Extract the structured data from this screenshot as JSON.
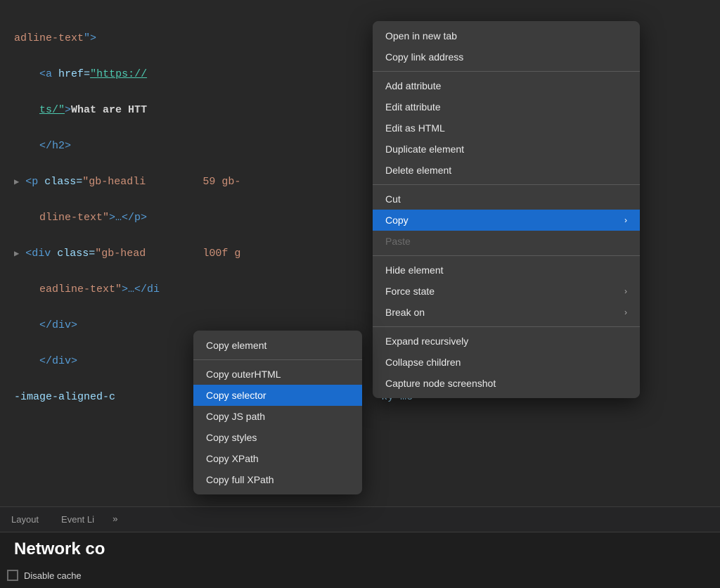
{
  "code_editor": {
    "lines": [
      {
        "content": "adline-text\">"
      },
      {
        "content": "  <a href=\"https://...\" ...>What are HTT"
      },
      {
        "content": "  ts/\">What are HTT"
      },
      {
        "content": "  </h2>"
      },
      {
        "content": "▶ <p class=\"gb-headli"
      },
      {
        "content": "  dline-text\">…</p>"
      },
      {
        "content": "▶ <div class=\"gb-head"
      },
      {
        "content": "  eadline-text\">…</di"
      },
      {
        "content": "  </div>"
      },
      {
        "content": "  </div>"
      },
      {
        "content": "-image-aligned-c"
      }
    ]
  },
  "right_context_menu": {
    "items": [
      {
        "id": "open-new-tab",
        "label": "Open in new tab",
        "type": "item",
        "has_arrow": false,
        "disabled": false
      },
      {
        "id": "copy-link-address",
        "label": "Copy link address",
        "type": "item",
        "has_arrow": false,
        "disabled": false
      },
      {
        "id": "sep1",
        "type": "separator"
      },
      {
        "id": "add-attribute",
        "label": "Add attribute",
        "type": "item",
        "has_arrow": false,
        "disabled": false
      },
      {
        "id": "edit-attribute",
        "label": "Edit attribute",
        "type": "item",
        "has_arrow": false,
        "disabled": false
      },
      {
        "id": "edit-as-html",
        "label": "Edit as HTML",
        "type": "item",
        "has_arrow": false,
        "disabled": false
      },
      {
        "id": "duplicate-element",
        "label": "Duplicate element",
        "type": "item",
        "has_arrow": false,
        "disabled": false
      },
      {
        "id": "delete-element",
        "label": "Delete element",
        "type": "item",
        "has_arrow": false,
        "disabled": false
      },
      {
        "id": "sep2",
        "type": "separator"
      },
      {
        "id": "cut",
        "label": "Cut",
        "type": "item",
        "has_arrow": false,
        "disabled": false
      },
      {
        "id": "copy",
        "label": "Copy",
        "type": "item",
        "has_arrow": true,
        "disabled": false,
        "highlighted": true
      },
      {
        "id": "paste",
        "label": "Paste",
        "type": "item",
        "has_arrow": false,
        "disabled": true
      },
      {
        "id": "sep3",
        "type": "separator"
      },
      {
        "id": "hide-element",
        "label": "Hide element",
        "type": "item",
        "has_arrow": false,
        "disabled": false
      },
      {
        "id": "force-state",
        "label": "Force state",
        "type": "item",
        "has_arrow": true,
        "disabled": false
      },
      {
        "id": "break-on",
        "label": "Break on",
        "type": "item",
        "has_arrow": true,
        "disabled": false
      },
      {
        "id": "sep4",
        "type": "separator"
      },
      {
        "id": "expand-recursively",
        "label": "Expand recursively",
        "type": "item",
        "has_arrow": false,
        "disabled": false
      },
      {
        "id": "collapse-children",
        "label": "Collapse children",
        "type": "item",
        "has_arrow": false,
        "disabled": false
      },
      {
        "id": "capture-screenshot",
        "label": "Capture node screenshot",
        "type": "item",
        "has_arrow": false,
        "disabled": false
      }
    ]
  },
  "left_context_menu": {
    "items": [
      {
        "id": "copy-element",
        "label": "Copy element",
        "type": "item",
        "highlighted": false
      },
      {
        "id": "sep1",
        "type": "separator"
      },
      {
        "id": "copy-outerhtml",
        "label": "Copy outerHTML",
        "type": "item",
        "highlighted": false
      },
      {
        "id": "copy-selector",
        "label": "Copy selector",
        "type": "item",
        "highlighted": true
      },
      {
        "id": "copy-js-path",
        "label": "Copy JS path",
        "type": "item",
        "highlighted": false
      },
      {
        "id": "copy-styles",
        "label": "Copy styles",
        "type": "item",
        "highlighted": false
      },
      {
        "id": "copy-xpath",
        "label": "Copy XPath",
        "type": "item",
        "highlighted": false
      },
      {
        "id": "copy-full-xpath",
        "label": "Copy full XPath",
        "type": "item",
        "highlighted": false
      }
    ]
  },
  "tab_bar": {
    "tabs": [
      {
        "id": "layout",
        "label": "Layout",
        "active": false
      },
      {
        "id": "event-listeners",
        "label": "Event Li",
        "active": false
      }
    ],
    "more_indicator": "»"
  },
  "bottom_bar": {
    "network_label": "Network co",
    "disable_cache_label": "Disable cache"
  },
  "icons": {
    "arrow_right": "›",
    "checkbox_empty": ""
  }
}
